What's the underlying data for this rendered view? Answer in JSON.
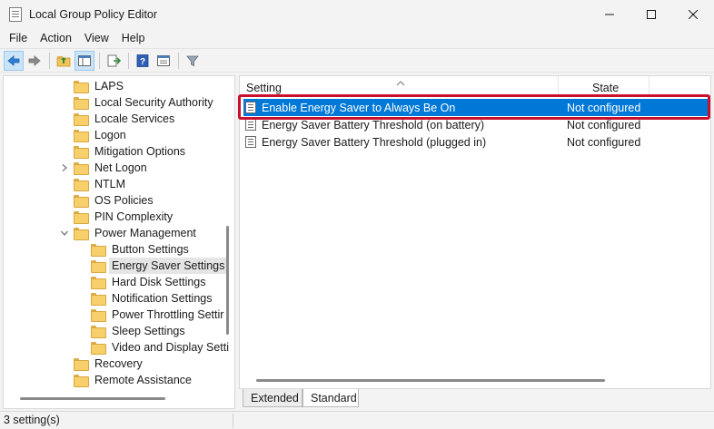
{
  "window": {
    "title": "Local Group Policy Editor"
  },
  "menu": [
    "File",
    "Action",
    "View",
    "Help"
  ],
  "toolbar": {
    "icons": [
      "back-arrow-icon",
      "forward-arrow-icon",
      "up-folder-icon",
      "show-hide-tree-icon",
      "export-list-icon",
      "help-icon",
      "properties-view-icon",
      "filter-icon"
    ]
  },
  "tree": {
    "items": [
      {
        "label": "LAPS",
        "expander": ""
      },
      {
        "label": "Local Security Authority",
        "expander": ""
      },
      {
        "label": "Locale Services",
        "expander": ""
      },
      {
        "label": "Logon",
        "expander": ""
      },
      {
        "label": "Mitigation Options",
        "expander": ""
      },
      {
        "label": "Net Logon",
        "expander": "collapsed"
      },
      {
        "label": "NTLM",
        "expander": ""
      },
      {
        "label": "OS Policies",
        "expander": ""
      },
      {
        "label": "PIN Complexity",
        "expander": ""
      },
      {
        "label": "Power Management",
        "expander": "expanded"
      },
      {
        "label": "Button Settings",
        "expander": ""
      },
      {
        "label": "Energy Saver Settings",
        "expander": "",
        "selected": true
      },
      {
        "label": "Hard Disk Settings",
        "expander": ""
      },
      {
        "label": "Notification Settings",
        "expander": ""
      },
      {
        "label": "Power Throttling Settir",
        "expander": ""
      },
      {
        "label": "Sleep Settings",
        "expander": ""
      },
      {
        "label": "Video and Display Setti",
        "expander": ""
      },
      {
        "label": "Recovery",
        "expander": ""
      },
      {
        "label": "Remote Assistance",
        "expander": ""
      }
    ]
  },
  "list": {
    "columns": {
      "setting": "Setting",
      "state": "State"
    },
    "rows": [
      {
        "setting": "Enable Energy Saver to Always Be On",
        "state": "Not configured",
        "selected": true
      },
      {
        "setting": "Energy Saver Battery Threshold (on battery)",
        "state": "Not configured"
      },
      {
        "setting": "Energy Saver Battery Threshold (plugged in)",
        "state": "Not configured"
      }
    ]
  },
  "tabs": {
    "extended": "Extended",
    "standard": "Standard"
  },
  "status": {
    "text": "3 setting(s)"
  },
  "colors": {
    "selection": "#0078d7",
    "highlight_box": "#c8102e"
  }
}
